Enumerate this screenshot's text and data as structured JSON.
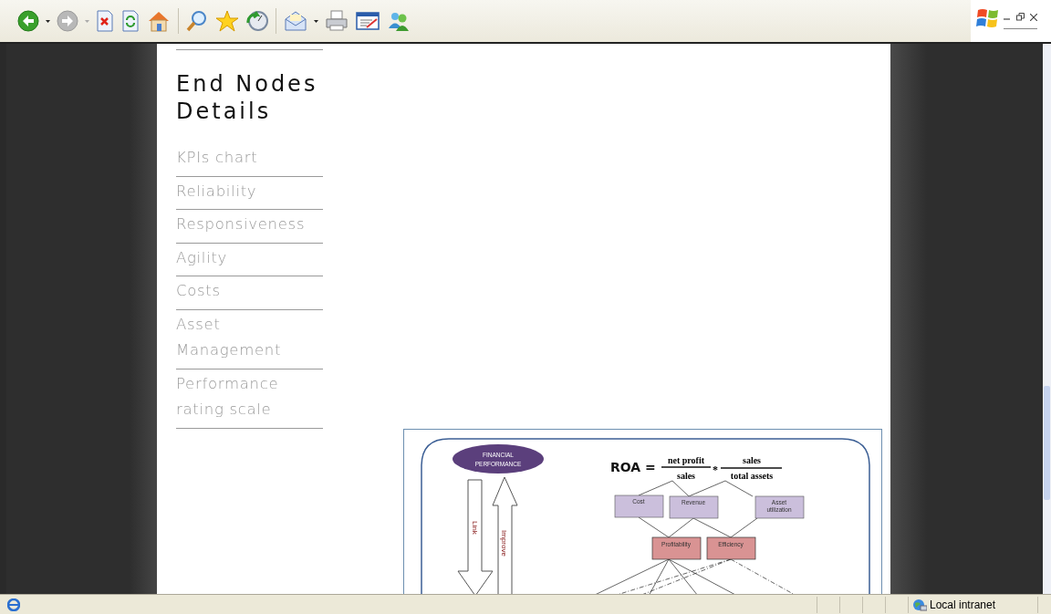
{
  "toolbar": [
    {
      "kind": "back",
      "disabled": false,
      "dropdown": true
    },
    {
      "kind": "forward",
      "disabled": true,
      "dropdown": true
    },
    {
      "kind": "stop"
    },
    {
      "kind": "refresh"
    },
    {
      "kind": "home"
    },
    {
      "kind": "separator"
    },
    {
      "kind": "search"
    },
    {
      "kind": "favorites"
    },
    {
      "kind": "history"
    },
    {
      "kind": "separator"
    },
    {
      "kind": "mail",
      "dropdown": true
    },
    {
      "kind": "print"
    },
    {
      "kind": "edit"
    },
    {
      "kind": "messenger"
    }
  ],
  "sidebar": {
    "heading": "End Nodes Details",
    "links": [
      "KPIs chart",
      "Reliability",
      "Responsiveness",
      "Agility",
      "Costs",
      "Asset Management",
      "Performance rating scale"
    ]
  },
  "figure": {
    "top_node": [
      "FINANCIAL",
      "PERFORMANCE"
    ],
    "down_arrow": "Link",
    "up_arrow": "Improve",
    "formula": {
      "lhs": "ROA =",
      "fraction_1": {
        "numerator": "net profit",
        "denominator": "sales"
      },
      "operator": "*",
      "fraction_2": {
        "numerator": "sales",
        "denominator": "total assets"
      }
    },
    "drivers": [
      [
        "Cost"
      ],
      [
        "Revenue"
      ],
      [
        "Asset",
        "utilization"
      ]
    ],
    "outcomes": [
      "Profitability",
      "Efficiency"
    ]
  },
  "status_bar": {
    "zone": "Local intranet"
  }
}
